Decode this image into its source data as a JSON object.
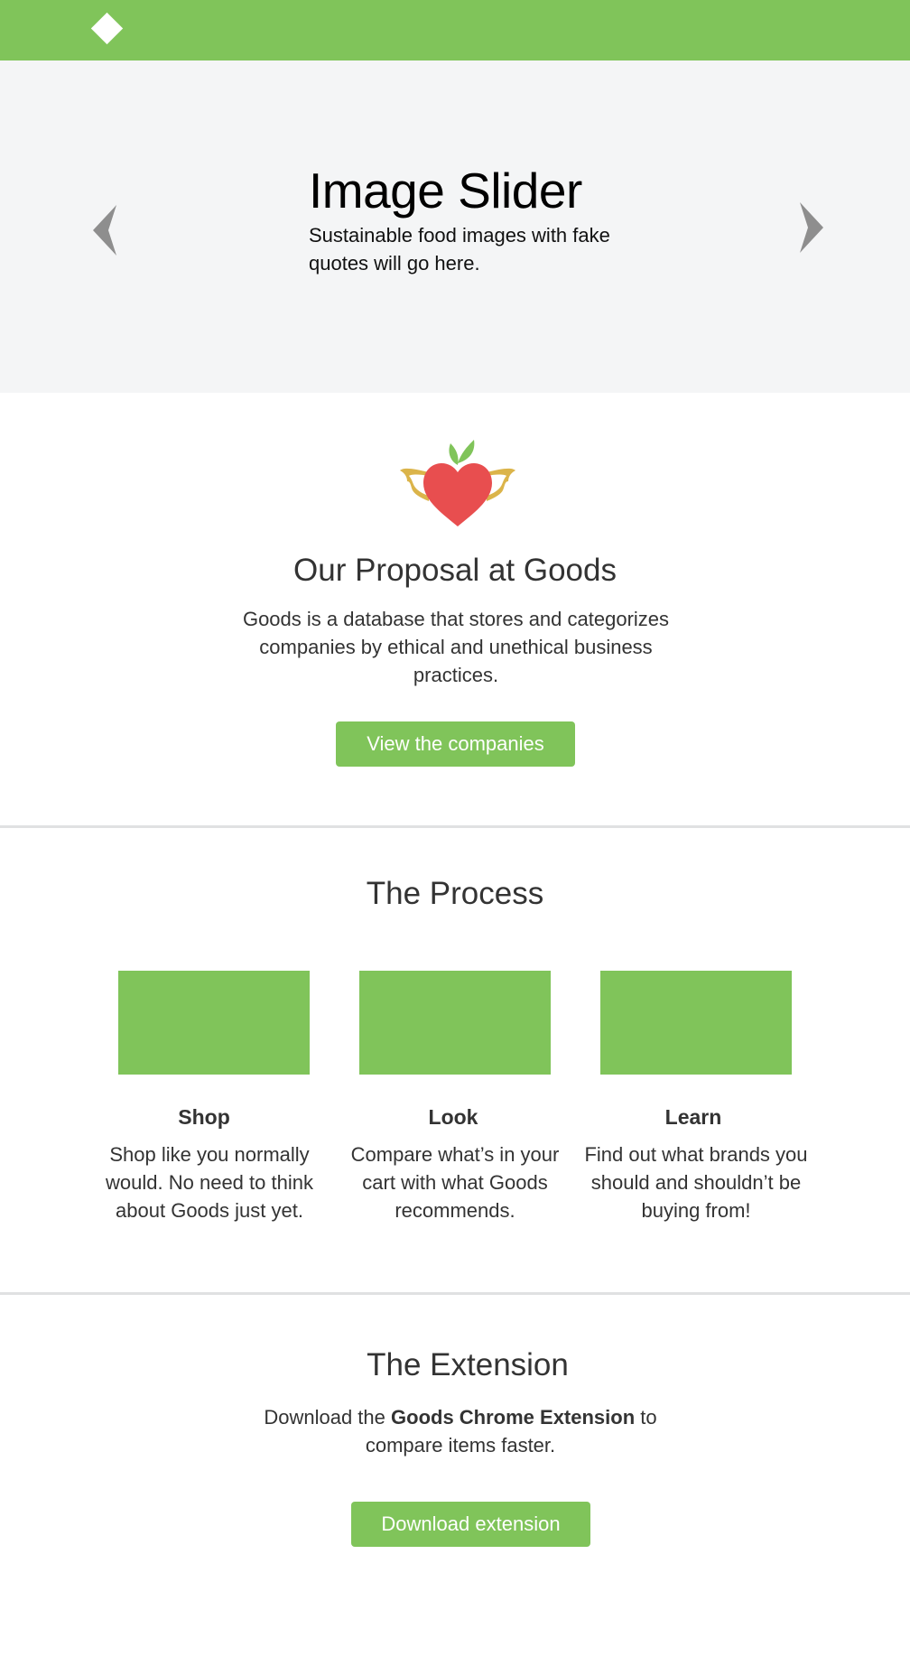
{
  "header": {
    "logo": "diamond-logo",
    "brand_color": "#80c45a"
  },
  "hero": {
    "title": "Image Slider",
    "subtitle": "Sustainable food images with fake quotes will go here.",
    "prev_icon": "chevron-left-icon",
    "next_icon": "chevron-right-icon"
  },
  "proposal": {
    "icon": "winged-apple-heart-icon",
    "title": "Our Proposal at Goods",
    "description": "Goods is a database that stores and categorizes companies by ethical and unethical business practices.",
    "button_label": "View the companies"
  },
  "process": {
    "title": "The Process",
    "steps": [
      {
        "title": "Shop",
        "text": "Shop like you normally would. No need to think about Goods just yet."
      },
      {
        "title": "Look",
        "text": "Compare what’s in your cart with what Goods recommends."
      },
      {
        "title": "Learn",
        "text": "Find out what brands you should and shouldn’t be buying from!"
      }
    ]
  },
  "extension": {
    "title": "The Extension",
    "text_before": "Download the ",
    "text_bold": "Goods Chrome Extension",
    "text_after": " to compare items faster.",
    "button_label": "Download extension"
  }
}
